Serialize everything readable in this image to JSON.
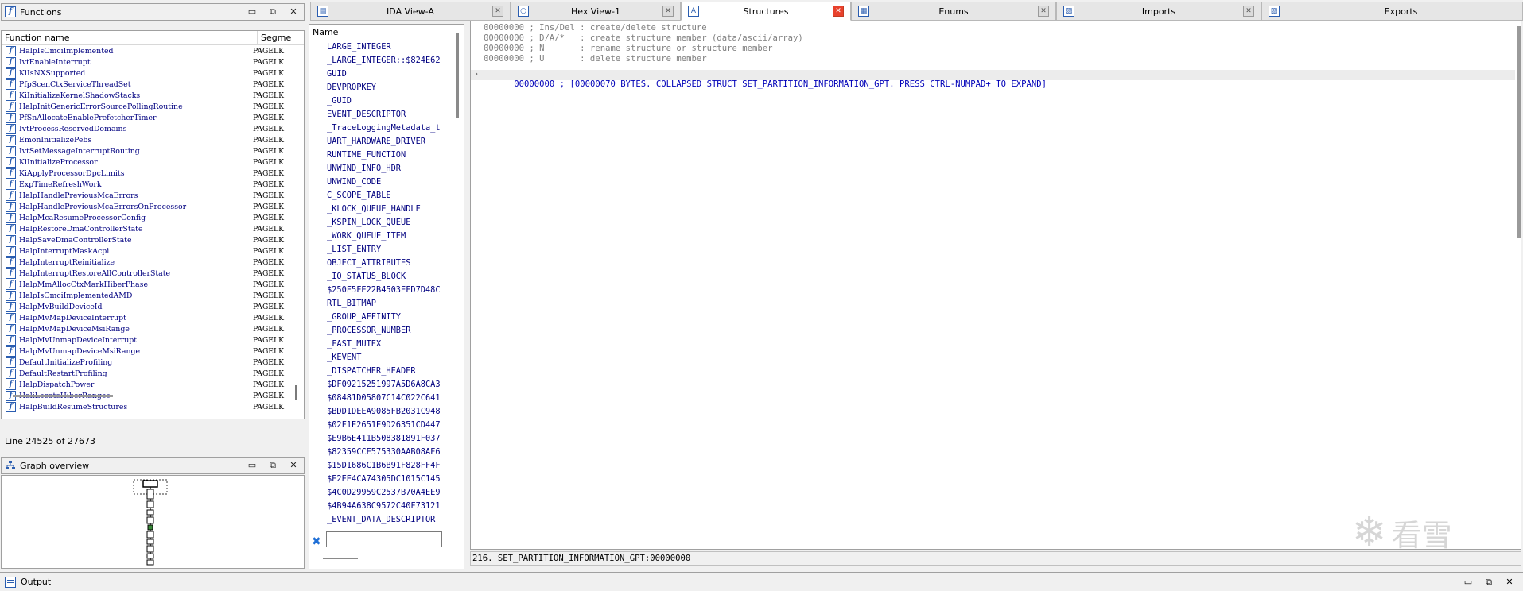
{
  "functions_pane": {
    "title": "Functions",
    "col_name": "Function name",
    "col_segment": "Segme",
    "rows": [
      {
        "name": "HalpIsCmciImplemented",
        "seg": "PAGELK"
      },
      {
        "name": "IvtEnableInterrupt",
        "seg": "PAGELK"
      },
      {
        "name": "KiIsNXSupported",
        "seg": "PAGELK"
      },
      {
        "name": "PfpScenCtxServiceThreadSet",
        "seg": "PAGELK"
      },
      {
        "name": "KiInitializeKernelShadowStacks",
        "seg": "PAGELK"
      },
      {
        "name": "HalpInitGenericErrorSourcePollingRoutine",
        "seg": "PAGELK"
      },
      {
        "name": "PfSnAllocateEnablePrefetcherTimer",
        "seg": "PAGELK"
      },
      {
        "name": "IvtProcessReservedDomains",
        "seg": "PAGELK"
      },
      {
        "name": "EmonInitializePebs",
        "seg": "PAGELK"
      },
      {
        "name": "IvtSetMessageInterruptRouting",
        "seg": "PAGELK"
      },
      {
        "name": "KiInitializeProcessor",
        "seg": "PAGELK"
      },
      {
        "name": "KiApplyProcessorDpcLimits",
        "seg": "PAGELK"
      },
      {
        "name": "ExpTimeRefreshWork",
        "seg": "PAGELK"
      },
      {
        "name": "HalpHandlePreviousMcaErrors",
        "seg": "PAGELK"
      },
      {
        "name": "HalpHandlePreviousMcaErrorsOnProcessor",
        "seg": "PAGELK"
      },
      {
        "name": "HalpMcaResumeProcessorConfig",
        "seg": "PAGELK"
      },
      {
        "name": "HalpRestoreDmaControllerState",
        "seg": "PAGELK"
      },
      {
        "name": "HalpSaveDmaControllerState",
        "seg": "PAGELK"
      },
      {
        "name": "HalpInterruptMaskAcpi",
        "seg": "PAGELK"
      },
      {
        "name": "HalpInterruptReinitialize",
        "seg": "PAGELK"
      },
      {
        "name": "HalpInterruptRestoreAllControllerState",
        "seg": "PAGELK"
      },
      {
        "name": "HalpMmAllocCtxMarkHiberPhase",
        "seg": "PAGELK"
      },
      {
        "name": "HalpIsCmciImplementedAMD",
        "seg": "PAGELK"
      },
      {
        "name": "HalpMvBuildDeviceId",
        "seg": "PAGELK"
      },
      {
        "name": "HalpMvMapDeviceInterrupt",
        "seg": "PAGELK"
      },
      {
        "name": "HalpMvMapDeviceMsiRange",
        "seg": "PAGELK"
      },
      {
        "name": "HalpMvUnmapDeviceInterrupt",
        "seg": "PAGELK"
      },
      {
        "name": "HalpMvUnmapDeviceMsiRange",
        "seg": "PAGELK"
      },
      {
        "name": "DefaultInitializeProfiling",
        "seg": "PAGELK"
      },
      {
        "name": "DefaultRestartProfiling",
        "seg": "PAGELK"
      },
      {
        "name": "HalpDispatchPower",
        "seg": "PAGELK"
      },
      {
        "name": "HaliLocateHiberRanges",
        "seg": "PAGELK"
      },
      {
        "name": "HalpBuildResumeStructures",
        "seg": "PAGELK"
      }
    ],
    "status": "Line 24525 of 27673"
  },
  "graph_pane": {
    "title": "Graph overview"
  },
  "structures_list": {
    "header": "Name",
    "items": [
      "LARGE_INTEGER",
      "_LARGE_INTEGER::$824E62",
      "GUID",
      "DEVPROPKEY",
      "_GUID",
      "EVENT_DESCRIPTOR",
      "_TraceLoggingMetadata_t",
      "UART_HARDWARE_DRIVER",
      "RUNTIME_FUNCTION",
      "UNWIND_INFO_HDR",
      "UNWIND_CODE",
      "C_SCOPE_TABLE",
      "_KLOCK_QUEUE_HANDLE",
      "_KSPIN_LOCK_QUEUE",
      "_WORK_QUEUE_ITEM",
      "_LIST_ENTRY",
      "OBJECT_ATTRIBUTES",
      "_IO_STATUS_BLOCK",
      "$250F5FE22B4503EFD7D48C",
      "RTL_BITMAP",
      "_GROUP_AFFINITY",
      "_PROCESSOR_NUMBER",
      "_FAST_MUTEX",
      "_KEVENT",
      "_DISPATCHER_HEADER",
      "$DF09215251997A5D6A8CA3",
      "$08481D05807C14C022C641",
      "$BDD1DEEA9085FB2031C948",
      "$02F1E2651E9D26351CD447",
      "$E9B6E411B508381891F037",
      "$82359CCE575330AAB08AF6",
      "$15D1686C1B6B91F828FF4F",
      "$E2EE4CA74305DC1015C145",
      "$4C0D29959C2537B70A4EE9",
      "$4B94A638C9572C40F73121",
      "_EVENT_DATA_DESCRIPTOR"
    ],
    "filter_value": ""
  },
  "tabs": [
    {
      "label": "IDA View-A",
      "icon": "ida-view-icon"
    },
    {
      "label": "Hex View-1",
      "icon": "hex-view-icon"
    },
    {
      "label": "Structures",
      "icon": "structures-icon"
    },
    {
      "label": "Enums",
      "icon": "enums-icon"
    },
    {
      "label": "Imports",
      "icon": "imports-icon"
    },
    {
      "label": "Exports",
      "icon": "exports-icon"
    }
  ],
  "main_view": {
    "lines": [
      "00000000 ; Ins/Del : create/delete structure",
      "00000000 ; D/A/*   : create structure member (data/ascii/array)",
      "00000000 ; N       : rename structure or structure member",
      "00000000 ; U       : delete structure member",
      "00000000 ; [00000070 BYTES. COLLAPSED STRUCT SET_PARTITION_INFORMATION_GPT. PRESS CTRL-NUMPAD+ TO EXPAND]"
    ],
    "status": "216. SET_PARTITION_INFORMATION_GPT:00000000"
  },
  "output_pane": {
    "title": "Output"
  },
  "watermark": "看雪",
  "pane_controls": {
    "minimize": "▭",
    "restore": "⧉",
    "close": "✕"
  }
}
